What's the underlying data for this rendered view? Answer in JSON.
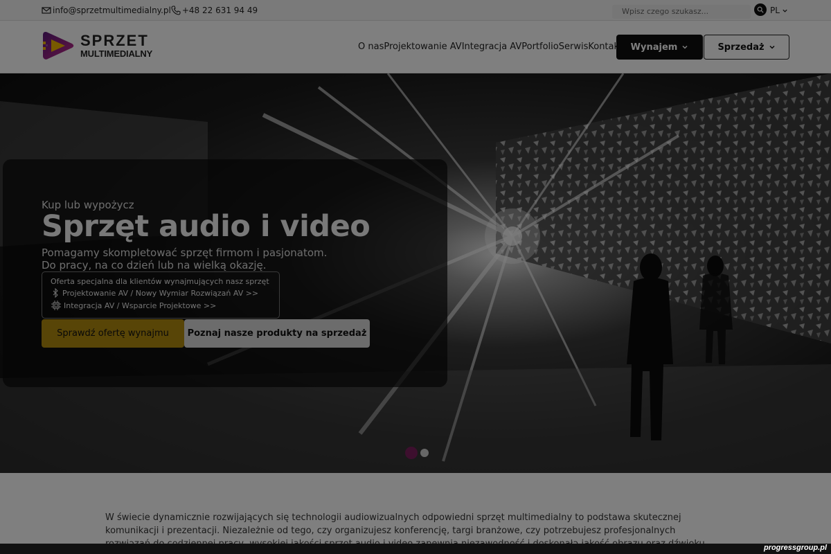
{
  "topbar": {
    "email": "info@sprzetmultimedialny.pl",
    "phone": "+48 22 631 94 49",
    "search_placeholder": "Wpisz czego szukasz...",
    "language": "PL"
  },
  "header": {
    "logo_line1": "SPRZET",
    "logo_line2": "MULTIMEDIALNY",
    "nav": [
      "O nas",
      "Projektowanie AV",
      "Integracja AV",
      "Portfolio",
      "Serwis",
      "Kontakt"
    ],
    "rent_button": "Wynajem",
    "sale_button": "Sprzedaż"
  },
  "hero": {
    "eyebrow": "Kup lub wypożycz",
    "title": "Sprzęt audio i video",
    "subtitle_line1": "Pomagamy skompletować sprzęt firmom i pasjonatom.",
    "subtitle_line2": "Do pracy, na co dzień lub na wielką okazję.",
    "offer_title": "Oferta specjalna dla klientów wynajmujących nasz sprzęt",
    "offer_links": [
      "Projektowanie AV / Nowy Wymiar Rozwiązań AV >>",
      "Integracja AV / Wsparcie Projektowe >>"
    ],
    "primary_cta": "Sprawdź ofertę wynajmu",
    "secondary_cta": "Poznaj nasze produkty na sprzedaż",
    "slides": 2,
    "active_slide": 1
  },
  "intro": {
    "text": "W świecie dynamicznie rozwijających się technologii audiowizualnych odpowiedni sprzęt multimedialny to podstawa skutecznej komunikacji i prezentacji. Niezależnie od tego, czy organizujesz konferencję, targi branżowe, czy potrzebujesz profesjonalnych rozwiązań do codziennej pracy, wysokiej jakości sprzęt audio i video zapewnia niezawodność i doskonałą jakość obrazu oraz dźwięku. Nasza firma specjalizuje się w sprzedaży i"
  },
  "footer": {
    "brand": "progressgroup.pl"
  },
  "colors": {
    "accent": "#b08a0e",
    "brand": "#7a1f5c",
    "dark": "#0f0f0f"
  }
}
